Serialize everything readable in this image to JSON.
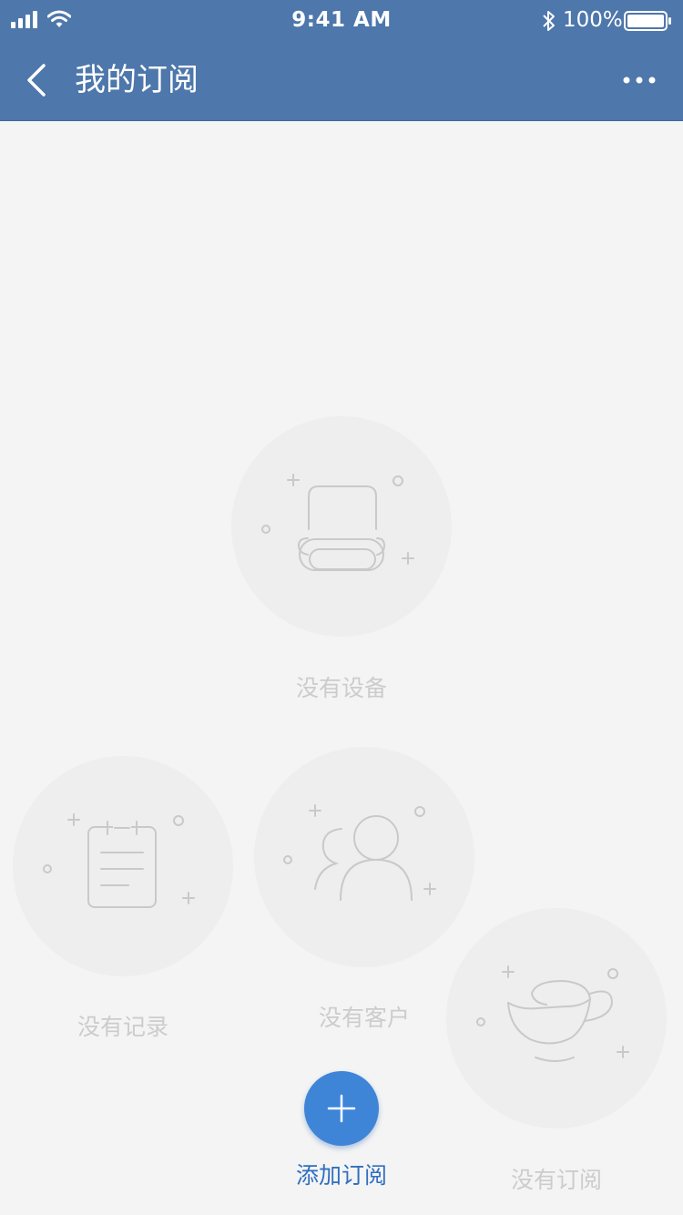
{
  "status_bar": {
    "time": "9:41 AM",
    "battery_percent": "100%",
    "signal_icon": "signal-bars-icon",
    "wifi_icon": "wifi-icon",
    "bluetooth_icon": "bluetooth-icon",
    "battery_icon": "battery-icon",
    "battery_level": 1.0
  },
  "nav": {
    "back_icon": "chevron-left-icon",
    "title": "我的订阅",
    "more_icon": "ellipsis-icon"
  },
  "empty_states": [
    {
      "label": "没有设备",
      "icon": "device-icon"
    },
    {
      "label": "没有记录",
      "icon": "clipboard-icon"
    },
    {
      "label": "没有客户",
      "icon": "users-icon"
    },
    {
      "label": "没有订阅",
      "icon": "cup-icon"
    }
  ],
  "add_button": {
    "icon": "plus-icon",
    "label": "添加订阅"
  },
  "colors": {
    "header": "#4e77ab",
    "background": "#f4f4f4",
    "circle": "#eeeeee",
    "muted_text": "#cccccc",
    "accent": "#3e85d8",
    "accent_text": "#2f6fbf"
  }
}
